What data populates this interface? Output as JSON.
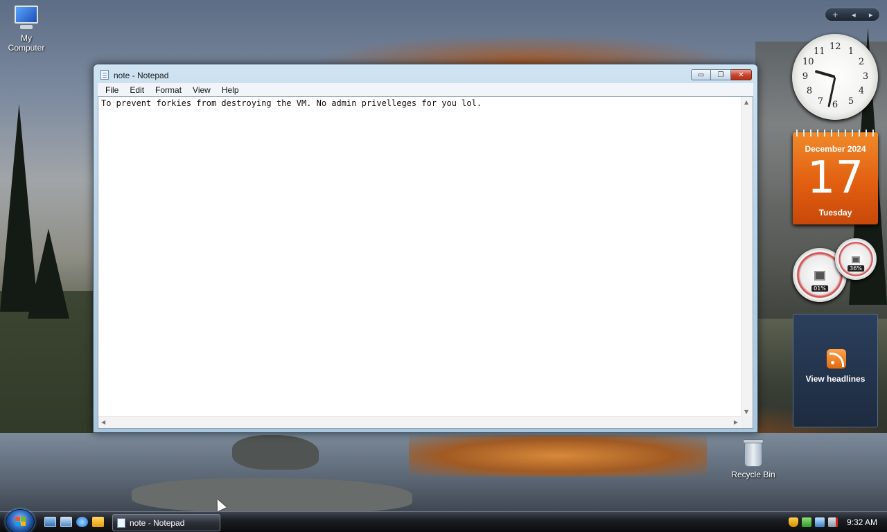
{
  "desktop": {
    "icons": [
      {
        "label": "My\nComputer",
        "icon": "computer-icon"
      },
      {
        "label": "Recycle Bin",
        "icon": "recycle-bin-icon"
      }
    ]
  },
  "window": {
    "title": "note - Notepad",
    "menu": [
      "File",
      "Edit",
      "Format",
      "View",
      "Help"
    ],
    "content": "To prevent forkies from destroying the VM. No admin privelleges for you lol.",
    "buttons": {
      "minimize": "▭",
      "maximize": "❐",
      "close": "✕"
    }
  },
  "gadgets": {
    "clock": {
      "numbers": [
        "12",
        "1",
        "2",
        "3",
        "4",
        "5",
        "6",
        "7",
        "8",
        "9",
        "10",
        "11"
      ],
      "hour": 9,
      "minute": 32
    },
    "calendar": {
      "month": "December 2024",
      "day": "17",
      "weekday": "Tuesday"
    },
    "cpu_meter": {
      "cpu": "01%",
      "memory": "36%"
    },
    "feed": {
      "label": "View headlines"
    },
    "sidebar_controls": {
      "add": "+",
      "prev": "◂",
      "next": "▸"
    }
  },
  "taskbar": {
    "task_button": "note - Notepad",
    "time": "9:32 AM",
    "quick_launch": [
      "show-desktop-icon",
      "switch-windows-icon",
      "internet-explorer-icon",
      "media-player-icon"
    ],
    "tray": [
      "security-shield-icon",
      "defender-icon",
      "network-icon",
      "volume-muted-icon"
    ]
  },
  "colors": {
    "calendar": "#e25f11",
    "taskbar": "#1b1e24",
    "title_bar": "#b8d2e6"
  }
}
